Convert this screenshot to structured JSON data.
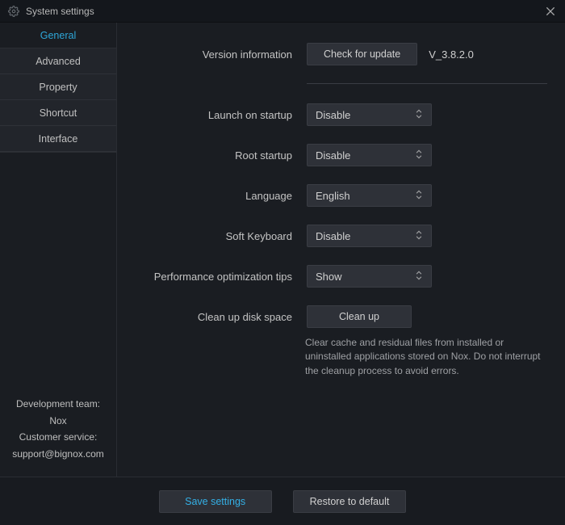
{
  "window": {
    "title": "System settings"
  },
  "sidebar": {
    "tabs": [
      {
        "label": "General",
        "active": true
      },
      {
        "label": "Advanced",
        "active": false
      },
      {
        "label": "Property",
        "active": false
      },
      {
        "label": "Shortcut",
        "active": false
      },
      {
        "label": "Interface",
        "active": false
      }
    ],
    "footer": {
      "line1": "Development team: Nox",
      "line2": "Customer service:",
      "line3": "support@bignox.com"
    }
  },
  "main": {
    "version": {
      "label": "Version information",
      "button": "Check for update",
      "value": "V_3.8.2.0"
    },
    "settings": [
      {
        "label": "Launch on startup",
        "value": "Disable"
      },
      {
        "label": "Root startup",
        "value": "Disable"
      },
      {
        "label": "Language",
        "value": "English"
      },
      {
        "label": "Soft Keyboard",
        "value": "Disable"
      },
      {
        "label": "Performance optimization tips",
        "value": "Show"
      }
    ],
    "cleanup": {
      "label": "Clean up disk space",
      "button": "Clean up",
      "hint": "Clear cache and residual files from installed or uninstalled applications stored on Nox. Do not interrupt the cleanup process to avoid errors."
    }
  },
  "footer": {
    "save": "Save settings",
    "restore": "Restore to default"
  }
}
